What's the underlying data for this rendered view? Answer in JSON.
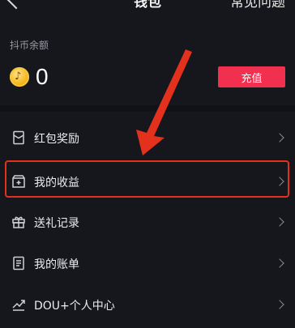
{
  "header": {
    "title": "钱包",
    "faq": "常见问题"
  },
  "balance": {
    "label": "抖币余额",
    "value": "0",
    "recharge_label": "充值"
  },
  "menu": {
    "items": [
      {
        "label": "红包奖励",
        "icon": "red-packet-icon"
      },
      {
        "label": "我的收益",
        "icon": "earnings-icon"
      },
      {
        "label": "送礼记录",
        "icon": "gift-icon"
      },
      {
        "label": "我的账单",
        "icon": "bill-icon"
      },
      {
        "label": "DOU+个人中心",
        "icon": "dou-plus-icon"
      }
    ]
  },
  "colors": {
    "accent": "#f0304e",
    "annotation": "#e3311e",
    "background": "#16171c"
  }
}
